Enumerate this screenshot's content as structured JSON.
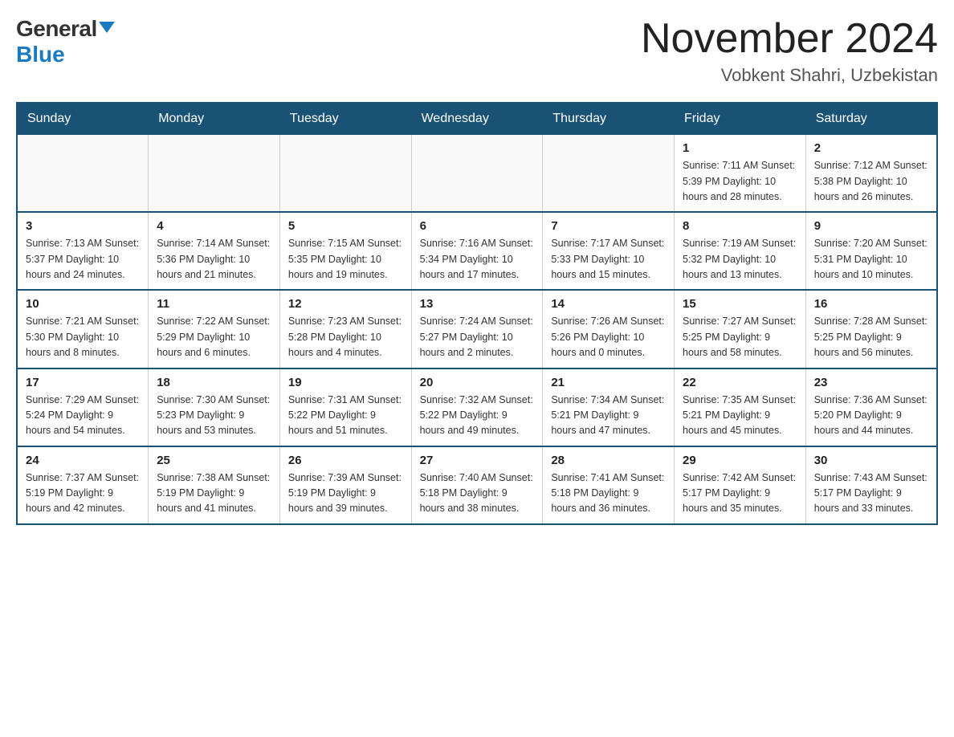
{
  "header": {
    "logo_general": "General",
    "logo_blue": "Blue",
    "month_title": "November 2024",
    "location": "Vobkent Shahri, Uzbekistan"
  },
  "weekdays": [
    "Sunday",
    "Monday",
    "Tuesday",
    "Wednesday",
    "Thursday",
    "Friday",
    "Saturday"
  ],
  "weeks": [
    [
      {
        "day": "",
        "info": ""
      },
      {
        "day": "",
        "info": ""
      },
      {
        "day": "",
        "info": ""
      },
      {
        "day": "",
        "info": ""
      },
      {
        "day": "",
        "info": ""
      },
      {
        "day": "1",
        "info": "Sunrise: 7:11 AM\nSunset: 5:39 PM\nDaylight: 10 hours\nand 28 minutes."
      },
      {
        "day": "2",
        "info": "Sunrise: 7:12 AM\nSunset: 5:38 PM\nDaylight: 10 hours\nand 26 minutes."
      }
    ],
    [
      {
        "day": "3",
        "info": "Sunrise: 7:13 AM\nSunset: 5:37 PM\nDaylight: 10 hours\nand 24 minutes."
      },
      {
        "day": "4",
        "info": "Sunrise: 7:14 AM\nSunset: 5:36 PM\nDaylight: 10 hours\nand 21 minutes."
      },
      {
        "day": "5",
        "info": "Sunrise: 7:15 AM\nSunset: 5:35 PM\nDaylight: 10 hours\nand 19 minutes."
      },
      {
        "day": "6",
        "info": "Sunrise: 7:16 AM\nSunset: 5:34 PM\nDaylight: 10 hours\nand 17 minutes."
      },
      {
        "day": "7",
        "info": "Sunrise: 7:17 AM\nSunset: 5:33 PM\nDaylight: 10 hours\nand 15 minutes."
      },
      {
        "day": "8",
        "info": "Sunrise: 7:19 AM\nSunset: 5:32 PM\nDaylight: 10 hours\nand 13 minutes."
      },
      {
        "day": "9",
        "info": "Sunrise: 7:20 AM\nSunset: 5:31 PM\nDaylight: 10 hours\nand 10 minutes."
      }
    ],
    [
      {
        "day": "10",
        "info": "Sunrise: 7:21 AM\nSunset: 5:30 PM\nDaylight: 10 hours\nand 8 minutes."
      },
      {
        "day": "11",
        "info": "Sunrise: 7:22 AM\nSunset: 5:29 PM\nDaylight: 10 hours\nand 6 minutes."
      },
      {
        "day": "12",
        "info": "Sunrise: 7:23 AM\nSunset: 5:28 PM\nDaylight: 10 hours\nand 4 minutes."
      },
      {
        "day": "13",
        "info": "Sunrise: 7:24 AM\nSunset: 5:27 PM\nDaylight: 10 hours\nand 2 minutes."
      },
      {
        "day": "14",
        "info": "Sunrise: 7:26 AM\nSunset: 5:26 PM\nDaylight: 10 hours\nand 0 minutes."
      },
      {
        "day": "15",
        "info": "Sunrise: 7:27 AM\nSunset: 5:25 PM\nDaylight: 9 hours\nand 58 minutes."
      },
      {
        "day": "16",
        "info": "Sunrise: 7:28 AM\nSunset: 5:25 PM\nDaylight: 9 hours\nand 56 minutes."
      }
    ],
    [
      {
        "day": "17",
        "info": "Sunrise: 7:29 AM\nSunset: 5:24 PM\nDaylight: 9 hours\nand 54 minutes."
      },
      {
        "day": "18",
        "info": "Sunrise: 7:30 AM\nSunset: 5:23 PM\nDaylight: 9 hours\nand 53 minutes."
      },
      {
        "day": "19",
        "info": "Sunrise: 7:31 AM\nSunset: 5:22 PM\nDaylight: 9 hours\nand 51 minutes."
      },
      {
        "day": "20",
        "info": "Sunrise: 7:32 AM\nSunset: 5:22 PM\nDaylight: 9 hours\nand 49 minutes."
      },
      {
        "day": "21",
        "info": "Sunrise: 7:34 AM\nSunset: 5:21 PM\nDaylight: 9 hours\nand 47 minutes."
      },
      {
        "day": "22",
        "info": "Sunrise: 7:35 AM\nSunset: 5:21 PM\nDaylight: 9 hours\nand 45 minutes."
      },
      {
        "day": "23",
        "info": "Sunrise: 7:36 AM\nSunset: 5:20 PM\nDaylight: 9 hours\nand 44 minutes."
      }
    ],
    [
      {
        "day": "24",
        "info": "Sunrise: 7:37 AM\nSunset: 5:19 PM\nDaylight: 9 hours\nand 42 minutes."
      },
      {
        "day": "25",
        "info": "Sunrise: 7:38 AM\nSunset: 5:19 PM\nDaylight: 9 hours\nand 41 minutes."
      },
      {
        "day": "26",
        "info": "Sunrise: 7:39 AM\nSunset: 5:19 PM\nDaylight: 9 hours\nand 39 minutes."
      },
      {
        "day": "27",
        "info": "Sunrise: 7:40 AM\nSunset: 5:18 PM\nDaylight: 9 hours\nand 38 minutes."
      },
      {
        "day": "28",
        "info": "Sunrise: 7:41 AM\nSunset: 5:18 PM\nDaylight: 9 hours\nand 36 minutes."
      },
      {
        "day": "29",
        "info": "Sunrise: 7:42 AM\nSunset: 5:17 PM\nDaylight: 9 hours\nand 35 minutes."
      },
      {
        "day": "30",
        "info": "Sunrise: 7:43 AM\nSunset: 5:17 PM\nDaylight: 9 hours\nand 33 minutes."
      }
    ]
  ]
}
